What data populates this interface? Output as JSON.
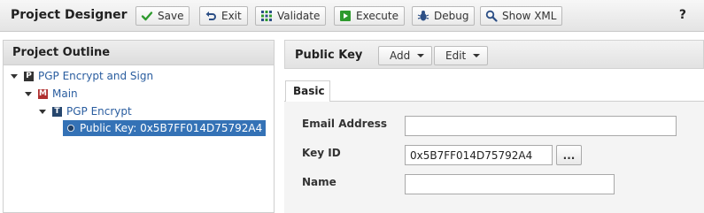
{
  "toolbar": {
    "title": "Project Designer",
    "buttons": [
      {
        "label": "Save",
        "icon": "check-icon"
      },
      {
        "label": "Exit",
        "icon": "undo-arrow-icon"
      },
      {
        "label": "Validate",
        "icon": "grid-icon"
      },
      {
        "label": "Execute",
        "icon": "play-icon"
      },
      {
        "label": "Debug",
        "icon": "bug-icon"
      },
      {
        "label": "Show XML",
        "icon": "magnifier-icon"
      }
    ],
    "help": "?"
  },
  "outline": {
    "header": "Project Outline",
    "nodes": [
      {
        "label": "PGP Encrypt and Sign",
        "icon_letter": "P",
        "icon_color": "#333333"
      },
      {
        "label": "Main",
        "icon_letter": "M",
        "icon_color": "#b03030"
      },
      {
        "label": "PGP Encrypt",
        "icon_letter": "T",
        "icon_color": "#26466d"
      },
      {
        "label": "Public Key: 0x5B7FF014D75792A4",
        "icon": "key-node-icon",
        "selected": true
      }
    ]
  },
  "detail": {
    "title": "Public Key",
    "add_label": "Add",
    "edit_label": "Edit",
    "tab": "Basic",
    "fields": {
      "email_label": "Email Address",
      "email_value": "",
      "keyid_label": "Key ID",
      "keyid_value": "0x5B7FF014D75792A4",
      "browse_label": "...",
      "name_label": "Name",
      "name_value": ""
    }
  },
  "colors": {
    "selection": "#3472b6",
    "link": "#2a5d9f",
    "accent_green": "#2e9a2e"
  }
}
